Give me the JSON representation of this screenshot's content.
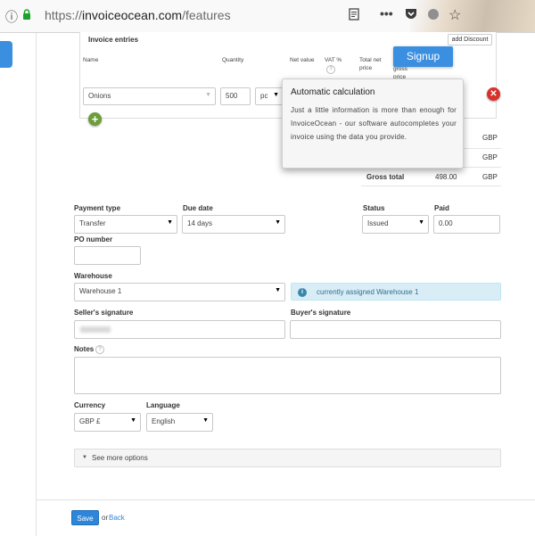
{
  "browser": {
    "url_scheme": "https://",
    "url_domain": "invoiceocean.com",
    "url_path": "/features"
  },
  "invoice_entries": {
    "title": "Invoice entries",
    "add_discount": "add Discount",
    "signup": "Signup",
    "columns": {
      "name": "Name",
      "quantity": "Quantity",
      "net_value": "Net value",
      "vat": "VAT %",
      "total_net": "Total net price",
      "gross": "gross price"
    },
    "row": {
      "name": "Onions",
      "quantity": "500",
      "unit": "pc"
    }
  },
  "tooltip": {
    "title": "Automatic calculation",
    "body": "Just a little information is more than enough for InvoiceOcean - our software autocompletes your invoice using the data you provide."
  },
  "totals": {
    "currency_1": "GBP",
    "currency_2": "GBP",
    "gross_label": "Gross total",
    "gross_value": "498.00",
    "gross_currency": "GBP"
  },
  "form": {
    "payment_type_label": "Payment type",
    "payment_type_value": "Transfer",
    "due_date_label": "Due date",
    "due_date_value": "14 days",
    "status_label": "Status",
    "status_value": "Issued",
    "paid_label": "Paid",
    "paid_value": "0.00",
    "po_label": "PO number",
    "warehouse_label": "Warehouse",
    "warehouse_value": "Warehouse 1",
    "warehouse_info": "currently assigned Warehouse 1",
    "seller_sig_label": "Seller's signature",
    "buyer_sig_label": "Buyer's signature",
    "notes_label": "Notes",
    "currency_label": "Currency",
    "currency_value": "GBP £",
    "language_label": "Language",
    "language_value": "English",
    "more_options": "See more options",
    "save": "Save",
    "or": "or",
    "back": "Back"
  },
  "colors": {
    "accent": "#3b8fe0",
    "save": "#2d86d9",
    "info_bg": "#d9edf7",
    "delete": "#d9302c",
    "add": "#6b9e3a"
  }
}
